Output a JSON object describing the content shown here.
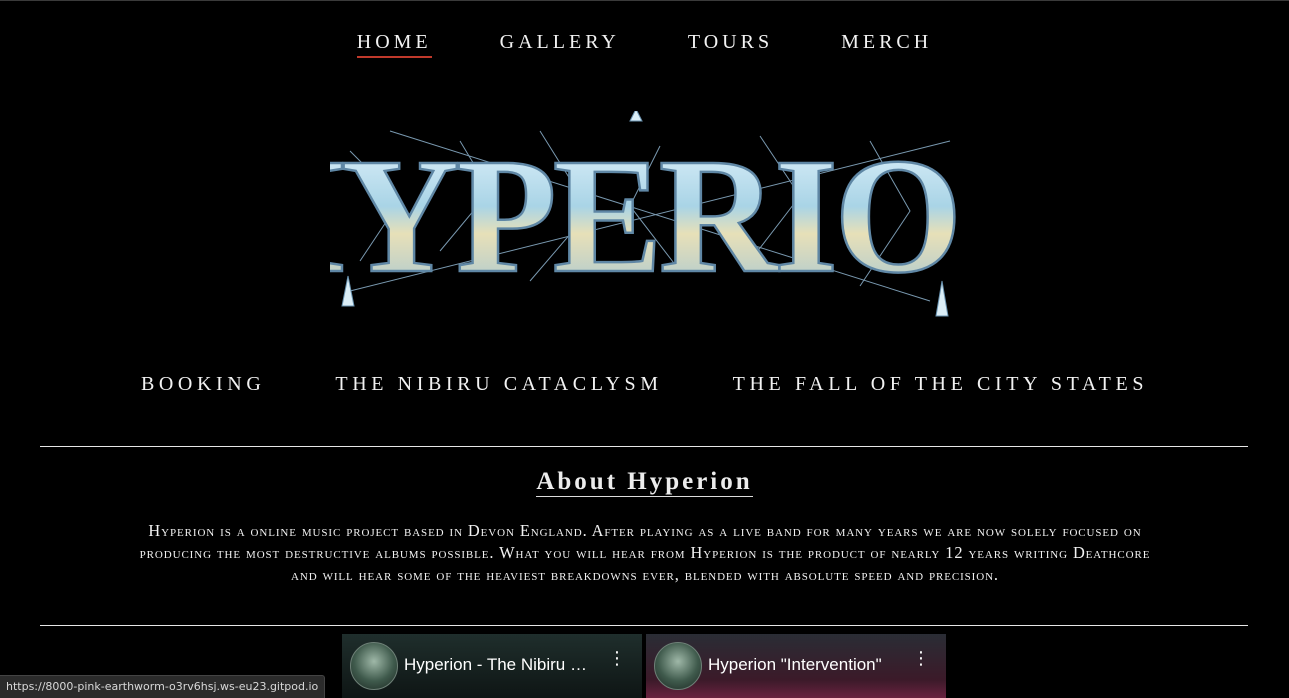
{
  "nav": {
    "items": [
      {
        "label": "HOME",
        "active": true
      },
      {
        "label": "GALLERY",
        "active": false
      },
      {
        "label": "TOURS",
        "active": false
      },
      {
        "label": "MERCH",
        "active": false
      }
    ]
  },
  "logo": {
    "text": "HYPERION",
    "colors": {
      "fill": "#cfe7ef",
      "stroke": "#7fa9c4",
      "glow": "#eaf7ff"
    }
  },
  "subnav": {
    "items": [
      {
        "label": "BOOKING"
      },
      {
        "label": "THE NIBIRU CATACLYSM"
      },
      {
        "label": "THE FALL OF THE CITY STATES"
      }
    ]
  },
  "about": {
    "title": "About Hyperion",
    "body": "Hyperion is a online music project based in Devon England. After playing as a live band for many years we are now solely focused on producing the most destructive albums possible. What you will hear from Hyperion is the product of nearly 12 years writing Deathcore and will hear some of the heaviest breakdowns ever, blended with absolute speed and precision."
  },
  "videos": [
    {
      "title": "Hyperion - The Nibiru Cataclysm",
      "icon": "more-vert-icon"
    },
    {
      "title": "Hyperion \"Intervention\"",
      "icon": "more-vert-icon"
    }
  ],
  "status": {
    "url": "https://8000-pink-earthworm-o3rv6hsj.ws-eu23.gitpod.io"
  },
  "colors": {
    "background": "#000000",
    "text": "#f2f2f2",
    "active_underline": "#c0392b",
    "rule": "#e6e6e6"
  }
}
